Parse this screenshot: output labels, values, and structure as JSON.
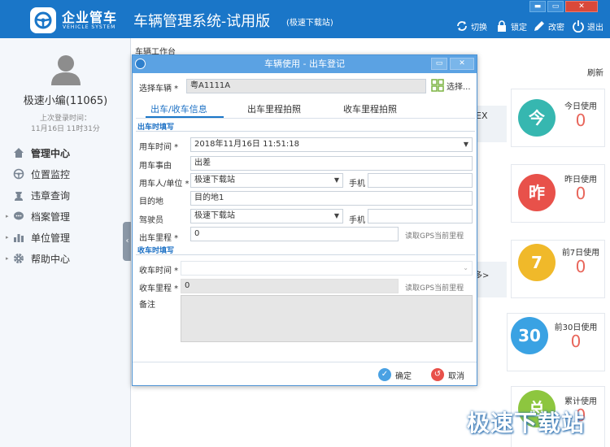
{
  "header": {
    "logo_cn": "企业管车",
    "logo_en": "VEHICLE SYSTEM",
    "title": "车辆管理系统-试用版",
    "subtitle": "(极速下载站)",
    "buttons": {
      "switch": "切换",
      "lock": "锁定",
      "change_pwd": "改密",
      "exit": "退出"
    },
    "window_controls": {
      "minimize": "▬",
      "restore": "▭",
      "close": "✕"
    }
  },
  "sidebar": {
    "username": "极速小编(11065)",
    "last_login_label": "上次登录时间：",
    "last_login_value": "11月16日 11时31分",
    "menu": [
      {
        "label": "管理中心",
        "icon": "home-icon"
      },
      {
        "label": "位置监控",
        "icon": "steering-wheel-icon"
      },
      {
        "label": "违章查询",
        "icon": "police-icon"
      },
      {
        "label": "档案管理",
        "icon": "chat-icon"
      },
      {
        "label": "单位管理",
        "icon": "bar-chart-icon"
      },
      {
        "label": "帮助中心",
        "icon": "gear-icon"
      }
    ]
  },
  "main": {
    "tab_workbench": "车辆工作台",
    "refresh": "刷新",
    "bg_ex": "EX",
    "bg_more": "多>",
    "stats": [
      {
        "circle": "今",
        "label": "今日使用",
        "value": "0",
        "color": "#36b7b0"
      },
      {
        "circle": "昨",
        "label": "昨日使用",
        "value": "0",
        "color": "#e8514a"
      },
      {
        "circle": "7",
        "label": "前7日使用",
        "value": "0",
        "color": "#f0b92a"
      },
      {
        "circle": "30",
        "label": "前30日使用",
        "value": "0",
        "color": "#3aa2e3"
      },
      {
        "circle": "总",
        "label": "累计使用",
        "value": "0",
        "color": "#8dc63f"
      }
    ]
  },
  "dialog": {
    "title": "车辆使用 - 出车登记",
    "controls": {
      "minimize": "▭",
      "close": "✕"
    },
    "select_vehicle_label": "选择车辆 *",
    "vehicle_value": "粤A1111A",
    "select_button": "选择...",
    "tabs": [
      "出车/收车信息",
      "出车里程拍照",
      "收车里程拍照"
    ],
    "section_out": "出车时填写",
    "section_in": "收车时填写",
    "fields": {
      "use_time_label": "用车时间 *",
      "use_time_value": "2018年11月16日 11:51:18",
      "reason_label": "用车事由",
      "reason_value": "出差",
      "user_label": "用车人/单位 *",
      "user_value": "极速下载站",
      "phone_label": "手机",
      "phone_value": "",
      "dest_label": "目的地",
      "dest_value": "目的地1",
      "driver_label": "驾驶员",
      "driver_value": "极速下载站",
      "phone2_label": "手机",
      "phone2_value": "",
      "out_mileage_label": "出车里程 *",
      "out_mileage_value": "0",
      "gps_read": "读取GPS当前里程",
      "return_time_label": "收车时间 *",
      "return_time_value": "",
      "return_mileage_label": "收车里程 *",
      "return_mileage_value": "0",
      "gps_read2": "读取GPS当前里程",
      "remark_label": "备注",
      "remark_value": ""
    },
    "confirm": "确定",
    "cancel": "取消"
  },
  "watermark": "极速下载站"
}
